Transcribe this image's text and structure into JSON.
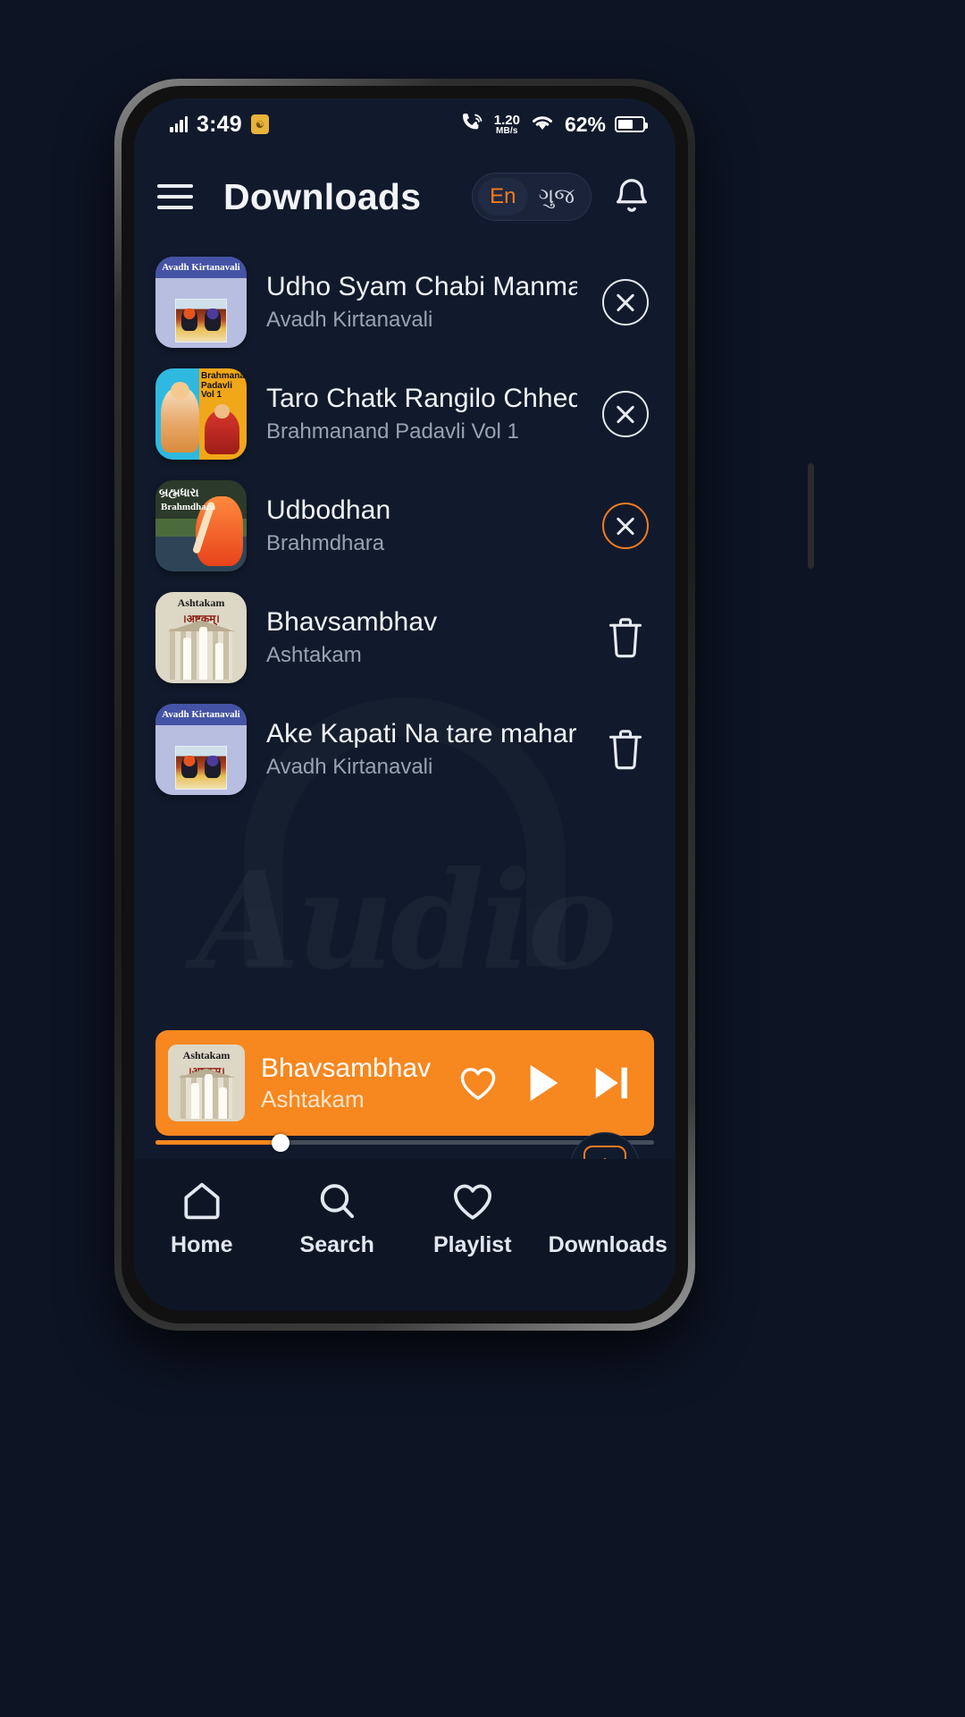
{
  "status_bar": {
    "time": "3:49",
    "signal_icon": "signal-bars-icon",
    "app_badge_icon": "app-notification-badge-icon",
    "call_wifi_icon": "vowifi-call-icon",
    "data_speed": "1.20",
    "data_speed_unit": "MB/s",
    "wifi_icon": "wifi-icon",
    "battery_percent": "62%",
    "battery_level": 62
  },
  "header": {
    "menu_icon": "hamburger-menu-icon",
    "title": "Downloads",
    "language_toggle": {
      "active": "En",
      "inactive": "ગુજ"
    },
    "bell_icon": "notification-bell-icon"
  },
  "watermark": {
    "text": "Audio"
  },
  "downloads": {
    "items": [
      {
        "title": "Udho Syam Chabi Manmani",
        "album": "Avadh Kirtanavali",
        "cover": "avadh",
        "cover_label": "Avadh Kirtanavali",
        "action": "cancel",
        "action_icon": "cancel-circle-icon",
        "highlighted": false
      },
      {
        "title": "Taro Chatk Rangilo Chhedlo",
        "album": "Brahmanand Padavli Vol 1",
        "cover": "brahmanand",
        "cover_label": "Brahmanand Padavli Vol 1",
        "action": "cancel",
        "action_icon": "cancel-circle-icon",
        "highlighted": false
      },
      {
        "title": "Udbodhan",
        "album": "Brahmdhara",
        "cover": "brahmdhara",
        "cover_label_native": "બ્રહ્મધારા",
        "cover_label": "Brahmdhara",
        "action": "cancel",
        "action_icon": "cancel-circle-icon",
        "highlighted": true
      },
      {
        "title": "Bhavsambhav",
        "album": "Ashtakam",
        "cover": "ashtakam",
        "cover_label": "Ashtakam",
        "cover_label_native": "।अष्टकम्।",
        "action": "delete",
        "action_icon": "trash-icon",
        "highlighted": false
      },
      {
        "title": "Ake Kapati Na tare maharaj",
        "album": "Avadh Kirtanavali",
        "cover": "avadh",
        "cover_label": "Avadh Kirtanavali",
        "action": "delete",
        "action_icon": "trash-icon",
        "highlighted": false
      }
    ]
  },
  "mini_player": {
    "title": "Bhavsambhav",
    "album": "Ashtakam",
    "cover": "ashtakam",
    "cover_label": "Ashtakam",
    "cover_label_native": "।अष्टकम्।",
    "favorite_icon": "heart-outline-icon",
    "play_icon": "play-icon",
    "next_icon": "next-track-icon",
    "progress_percent": 25,
    "accent_color": "#f7871f"
  },
  "bottom_nav": {
    "items": [
      {
        "label": "Home",
        "icon": "home-icon",
        "active": false
      },
      {
        "label": "Search",
        "icon": "search-icon",
        "active": false
      },
      {
        "label": "Playlist",
        "icon": "heart-outline-icon",
        "active": false
      },
      {
        "label": "Downloads",
        "icon": "download-icon",
        "active": true
      }
    ],
    "download_fab_icon": "download-arrow-icon"
  },
  "colors": {
    "accent": "#f7871f",
    "screen_bg": "#111a2c",
    "nav_bg": "#0e1626",
    "page_bg": "#0d1424"
  }
}
